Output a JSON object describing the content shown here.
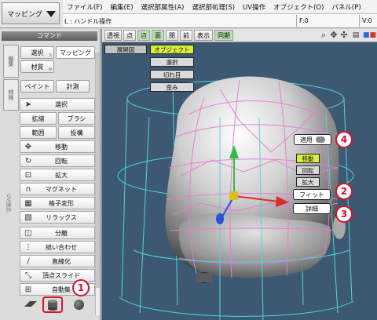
{
  "mode_button": {
    "label": "マッピング"
  },
  "menu": [
    "ファイル(F)",
    "編集(E)",
    "選択部属性(A)",
    "選択部処理(S)",
    "UV操作",
    "オブジェクト(O)",
    "パネル(P)"
  ],
  "status": {
    "left": "L : ハンドル操作",
    "mid": "F:0",
    "right": "V:0"
  },
  "panel": {
    "title": "コマンド",
    "tab_left_1": "編集",
    "tab_left_2": "特殊",
    "side_label": "UV操作",
    "top_buttons": {
      "select": "選択",
      "select_sub": "S",
      "mapping": "マッピング",
      "material": "材質",
      "material_sub": "M",
      "paint": "ペイント",
      "measure": "計測"
    },
    "tools": {
      "select": "選択",
      "expand": "拡縮",
      "brush": "ブラシ",
      "range": "範囲",
      "project": "投構",
      "move": "移動",
      "rotate": "回転",
      "scale": "拡大",
      "magnet": "マグネット",
      "lattice": "格子変形",
      "relax": "リラックス",
      "split": "分離",
      "stitch": "縫い合わせ",
      "straighten": "直線化",
      "vertex_slide": "頂点スライド",
      "auto_collect": "自動集"
    }
  },
  "viewport_toolbar": {
    "b1": "透視",
    "b2": "点",
    "b3": "辺",
    "b4": "面",
    "b5": "閉",
    "b6": "前",
    "b7": "表示",
    "b8": "同期"
  },
  "overlay": {
    "unwrap": "展開図",
    "object": "オブジェクト",
    "select": "選択",
    "seam": "切れ目",
    "distort": "歪み",
    "apply": "適用",
    "move": "移動",
    "rotate": "回転",
    "scale": "拡大",
    "fit": "フィット",
    "detail": "詳細"
  },
  "callouts": {
    "n1": "1",
    "n2": "2",
    "n3": "3",
    "n4": "4"
  },
  "colors": {
    "viewport_bg": "#3c5873",
    "wire": "#e87bd2",
    "cage": "#4fd6d8",
    "highlight": "#d8ef3a",
    "callout_red": "#d8102b",
    "sync_on": "#b8e0b0"
  }
}
